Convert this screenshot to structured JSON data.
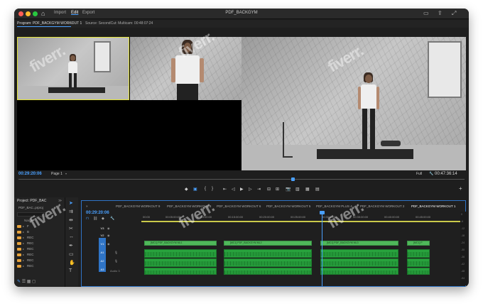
{
  "window": {
    "title": "PDF_BACKGYM",
    "menu_tabs": [
      {
        "label": "Import"
      },
      {
        "label": "Edit"
      },
      {
        "label": "Export"
      }
    ]
  },
  "monitor": {
    "program_label": "Program: PDF_BACKGYM WORKOUT 1",
    "program_menu": "≡",
    "source_label": "Source: SecondCut: Multicam: 00:48:07:24"
  },
  "transport": {
    "timecode_current": "00:29:20:06",
    "page": "Page 1",
    "fit": "Full",
    "timecode_duration": "00:47:36:14"
  },
  "project": {
    "title": "Project: PDF_BAC",
    "tab_indicator": "≫",
    "file_name": "PDF_BAC..prproj",
    "name_header": "Name",
    "bins": [
      {
        "label": "F"
      },
      {
        "label": "B"
      },
      {
        "label": "REC"
      },
      {
        "label": "REC"
      },
      {
        "label": "REC"
      },
      {
        "label": "REC"
      },
      {
        "label": "REC"
      },
      {
        "label": "REC"
      }
    ]
  },
  "timeline": {
    "timecode": "00:29:20:06",
    "sequence_tabs": [
      {
        "label": "PDF_BACKGYM WORKOUT 9"
      },
      {
        "label": "PDF_BACKGYM WORKOUT 8"
      },
      {
        "label": "PDF_BACKGYM WORKOUT 6"
      },
      {
        "label": "PDF_BACKGYM WORKOUT 5"
      },
      {
        "label": "PDF_BACKGYM PLUS 4"
      },
      {
        "label": "PDF_BACKGYM WORKOUT 2"
      },
      {
        "label": "PDF_BACKGYM WORKOUT 1"
      }
    ],
    "ruler": [
      "00:00",
      "00:05:00:00",
      "00:10:00:00",
      "00:15:00:00",
      "00:20:00:00",
      "00:25:00:00",
      "00:30:00:00",
      "00:35:00:00",
      "00:40:00:00",
      "00:45:00:00"
    ],
    "tracks": [
      {
        "tag": "V3"
      },
      {
        "tag": "V2"
      },
      {
        "tag": "V1"
      },
      {
        "tag": "A1"
      },
      {
        "tag": "A2"
      },
      {
        "tag": "A3"
      }
    ],
    "audio_label": "Audio 3",
    "video_clips": [
      {
        "label": "[MC1] PDF_BACKGYM ML1"
      },
      {
        "label": "[MC1] PDF_BACKGYM ML2"
      },
      {
        "label": "[MC1] PDF_BACKGYM ML3"
      },
      {
        "label": "[MC1] P"
      }
    ]
  },
  "vu_meter": [
    "0",
    "-6",
    "-12",
    "-18",
    "-24",
    "-30",
    "-36",
    "-42",
    "-48",
    "-54"
  ],
  "watermark": "fiverr.",
  "colors": {
    "accent": "#4aa0ff",
    "clip_video": "#4fb85a",
    "clip_audio": "#28a23d",
    "selection": "#e3e33a",
    "bin_folder": "#e8a33c"
  }
}
